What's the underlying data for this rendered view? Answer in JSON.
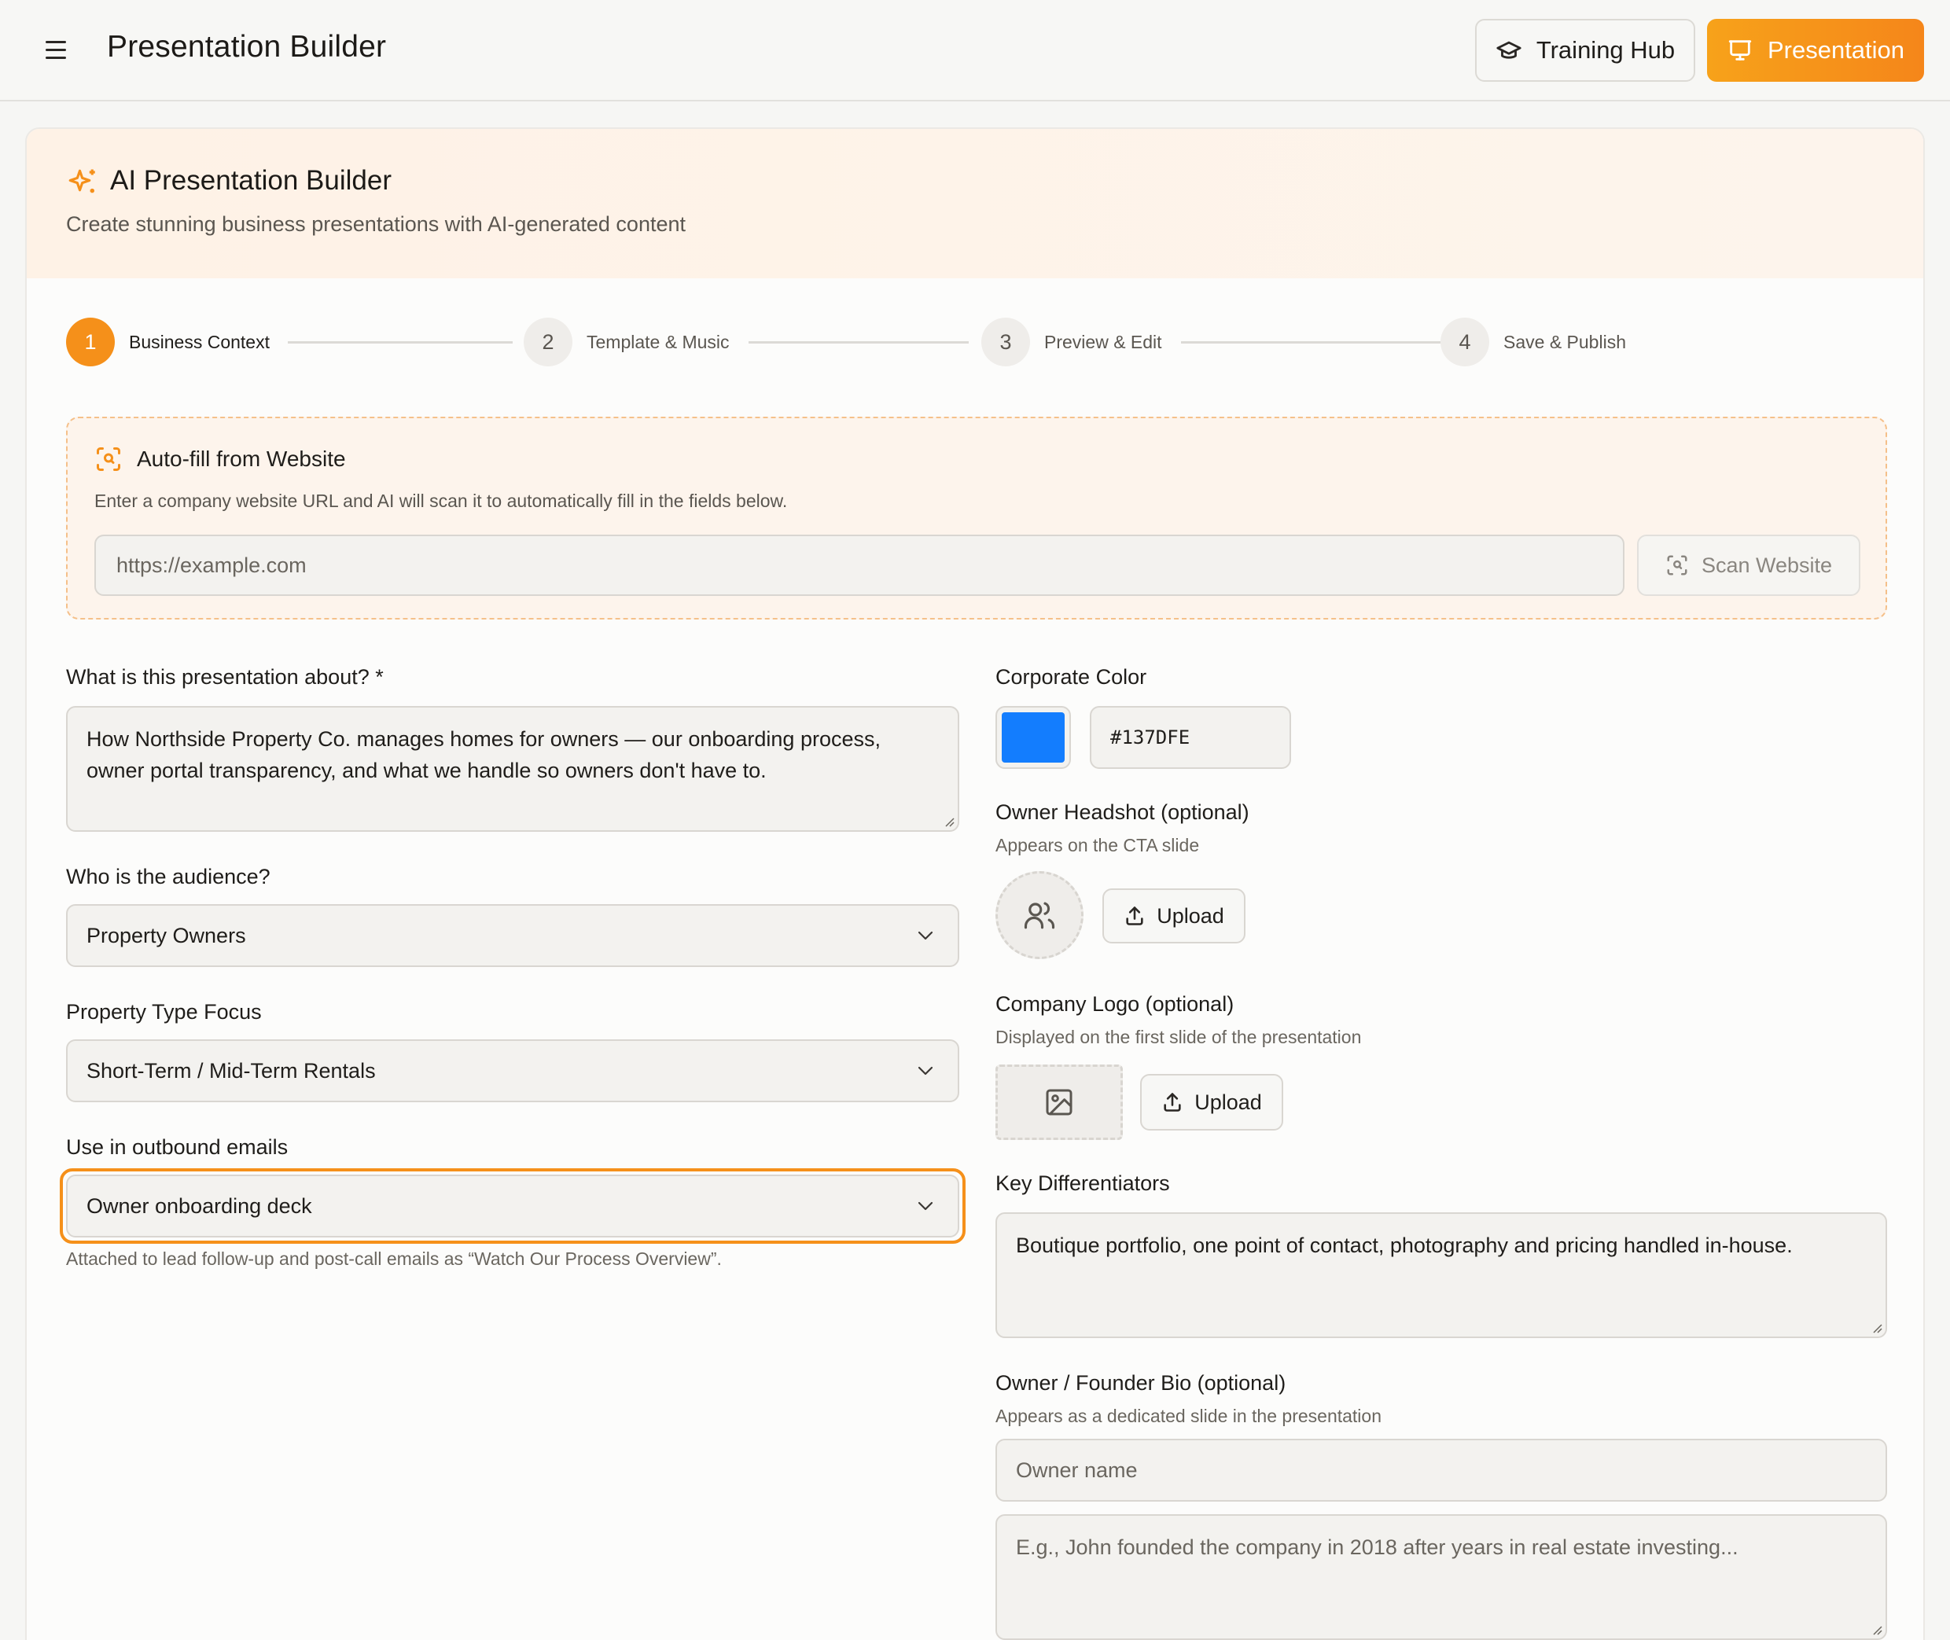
{
  "header": {
    "title": "Presentation Builder",
    "training_label": "Training Hub",
    "presentation_label": "Presentation"
  },
  "card": {
    "title": "AI Presentation Builder",
    "subtitle": "Create stunning business presentations with AI-generated content"
  },
  "steps": [
    {
      "number": "1",
      "label": "Business Context"
    },
    {
      "number": "2",
      "label": "Template & Music"
    },
    {
      "number": "3",
      "label": "Preview & Edit"
    },
    {
      "number": "4",
      "label": "Save & Publish"
    }
  ],
  "autofill": {
    "title": "Auto-fill from Website",
    "description": "Enter a company website URL and AI will scan it to automatically fill in the fields below.",
    "url_placeholder": "https://example.com",
    "scan_label": "Scan Website"
  },
  "form": {
    "about_label": "What is this presentation about? *",
    "about_value": "How Northside Property Co. manages homes for owners — our onboarding process, owner portal transparency, and what we handle so owners don't have to.",
    "audience_label": "Who is the audience?",
    "audience_value": "Property Owners",
    "property_label": "Property Type Focus",
    "property_value": "Short-Term / Mid-Term Rentals",
    "outbound_label": "Use in outbound emails",
    "outbound_value": "Owner onboarding deck",
    "outbound_hint": "Attached to lead follow-up and post-call emails as “Watch Our Process Overview”.",
    "color_label": "Corporate Color",
    "color_value": "#137DFE",
    "headshot_label": "Owner Headshot (optional)",
    "headshot_hint": "Appears on the CTA slide",
    "headshot_upload": "Upload",
    "logo_label": "Company Logo (optional)",
    "logo_hint": "Displayed on the first slide of the presentation",
    "logo_upload": "Upload",
    "diff_label": "Key Differentiators",
    "diff_value": "Boutique portfolio, one point of contact, photography and pricing handled in-house.",
    "bio_label": "Owner / Founder Bio (optional)",
    "bio_hint": "Appears as a dedicated slide in the presentation",
    "owner_name_placeholder": "Owner name",
    "bio_placeholder": "E.g., John founded the company in 2018 after years in real estate investing..."
  },
  "colors": {
    "accent": "#F5901A",
    "corporate": "#137DFE"
  },
  "icons": [
    "menu-icon",
    "graduation-cap-icon",
    "presentation-icon",
    "sparkle-icon",
    "scan-icon",
    "chevron-down-icon",
    "users-icon",
    "image-icon",
    "upload-icon"
  ]
}
